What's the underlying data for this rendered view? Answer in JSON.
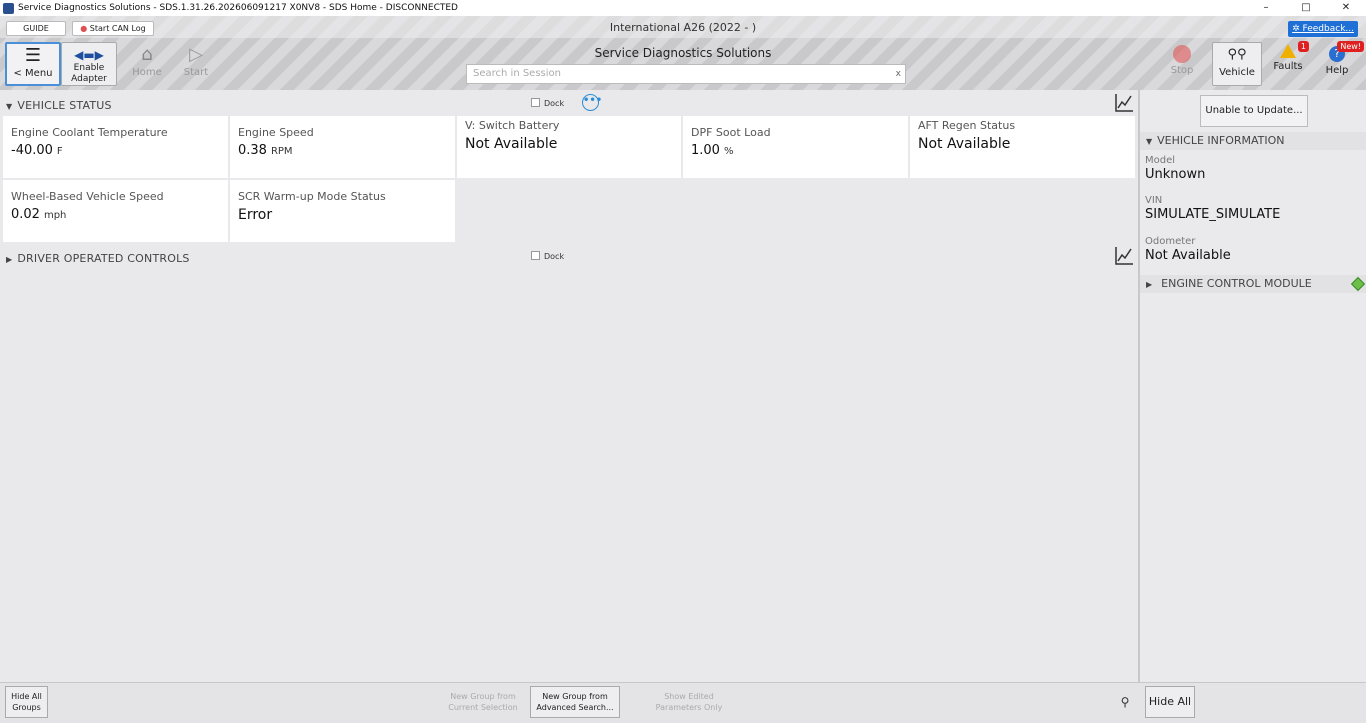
{
  "window": {
    "title": "Service Diagnostics Solutions - SDS.1.31.26.202606091217 X0NV8 - SDS Home - DISCONNECTED"
  },
  "topbar": {
    "guide_label": "GUIDE",
    "can_log_label": "Start CAN Log",
    "vehicle_title": "International A26 (2022 - )",
    "feedback_label": "Feedback...",
    "app_title": "Service Diagnostics Solutions",
    "search_placeholder": "Search in Session",
    "search_clear": "x",
    "menu_label": "< Menu",
    "enable_adapter_label_1": "Enable",
    "enable_adapter_label_2": "Adapter",
    "home_label": "Home",
    "start_label": "Start",
    "stop_label": "Stop",
    "vehicle_label": "Vehicle",
    "faults_label": "Faults",
    "faults_badge": "1",
    "help_label": "Help",
    "help_badge": "New!"
  },
  "vehicle_status": {
    "header": "VEHICLE STATUS",
    "dock_label": "Dock",
    "cards": [
      {
        "label": "Engine Coolant Temperature",
        "value": "-40.00",
        "unit": "F"
      },
      {
        "label": "Engine Speed",
        "value": "0.38",
        "unit": "RPM"
      },
      {
        "label": "V: Switch Battery",
        "value": "Not Available",
        "unit": ""
      },
      {
        "label": "DPF Soot Load",
        "value": "1.00",
        "unit": "%"
      },
      {
        "label": "AFT Regen Status",
        "value": "Not Available",
        "unit": ""
      },
      {
        "label": "Wheel-Based Vehicle Speed",
        "value": "0.02",
        "unit": "mph"
      },
      {
        "label": "SCR Warm-up Mode Status",
        "value": "Error",
        "unit": ""
      }
    ]
  },
  "driver_controls": {
    "header": "DRIVER OPERATED CONTROLS",
    "dock_label": "Dock"
  },
  "right_panel": {
    "update_button": "Unable to Update...",
    "vehicle_info_header": "VEHICLE INFORMATION",
    "model_label": "Model",
    "model_value": "Unknown",
    "vin_label": "VIN",
    "vin_value": "SIMULATE_SIMULATE",
    "odometer_label": "Odometer",
    "odometer_value": "Not Available",
    "ecm_header": "ENGINE CONTROL MODULE",
    "ecm_status_color": "#6cc04a"
  },
  "bottom": {
    "hide_all_groups_1": "Hide All",
    "hide_all_groups_2": "Groups",
    "new_group_sel_1": "New Group from",
    "new_group_sel_2": "Current Selection",
    "new_group_adv_1": "New Group from",
    "new_group_adv_2": "Advanced Search...",
    "show_edited_1": "Show Edited",
    "show_edited_2": "Parameters Only",
    "hide_all": "Hide All"
  }
}
